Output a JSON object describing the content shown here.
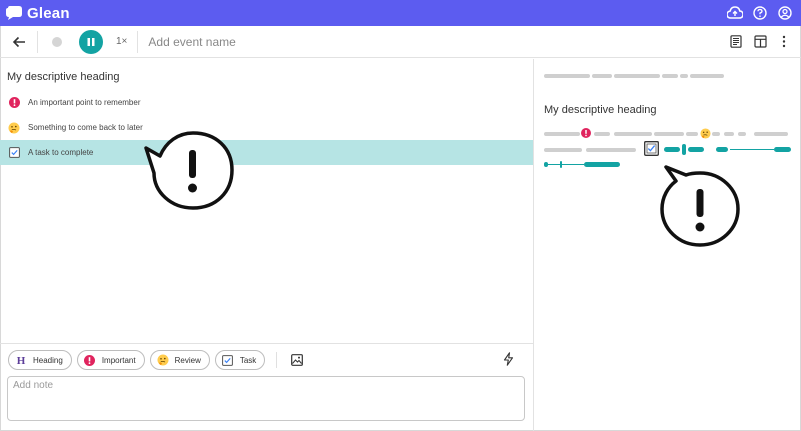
{
  "app": {
    "name": "Glean"
  },
  "toolbar": {
    "speed": "1×",
    "event_placeholder": "Add event name"
  },
  "notes": {
    "heading": "My descriptive heading",
    "items": [
      {
        "label": "An important point to remember",
        "icon": "important-icon"
      },
      {
        "label": "Something to come back to later",
        "icon": "thinking-emoji-icon"
      },
      {
        "label": "A task to complete",
        "icon": "task-checkbox-icon",
        "selected": true
      }
    ]
  },
  "compose": {
    "chips": [
      {
        "label": "Heading",
        "icon": "heading-icon"
      },
      {
        "label": "Important",
        "icon": "important-icon"
      },
      {
        "label": "Review",
        "icon": "thinking-emoji-icon"
      },
      {
        "label": "Task",
        "icon": "task-checkbox-icon"
      }
    ],
    "note_placeholder": "Add note"
  },
  "preview": {
    "heading": "My descriptive heading"
  },
  "colors": {
    "brand": "#5c5cf0",
    "accent": "#13a3a3",
    "selected_row": "#b6e4e4",
    "important": "#e0245e"
  }
}
